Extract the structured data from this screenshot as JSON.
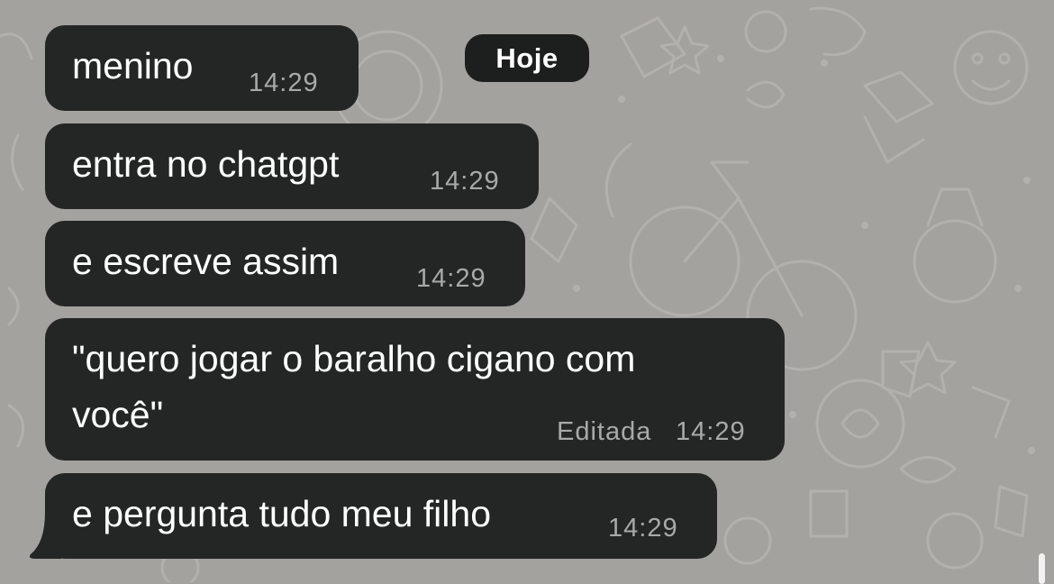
{
  "chat": {
    "date_label": "Hoje",
    "messages": [
      {
        "text": "menino",
        "time": "14:29"
      },
      {
        "text": "entra no chatgpt",
        "time": "14:29"
      },
      {
        "text": "e escreve assim",
        "time": "14:29"
      },
      {
        "text_line1": "\"quero jogar o baralho cigano com",
        "text_line2": "você\"",
        "edited_label": "Editada",
        "time": "14:29"
      },
      {
        "text": "e pergunta tudo meu filho",
        "time": "14:29"
      }
    ]
  },
  "colors": {
    "background": "#a4a29e",
    "bubble": "#242626",
    "timestamp": "#a8aaaa",
    "pill": "#1d1e1e"
  }
}
